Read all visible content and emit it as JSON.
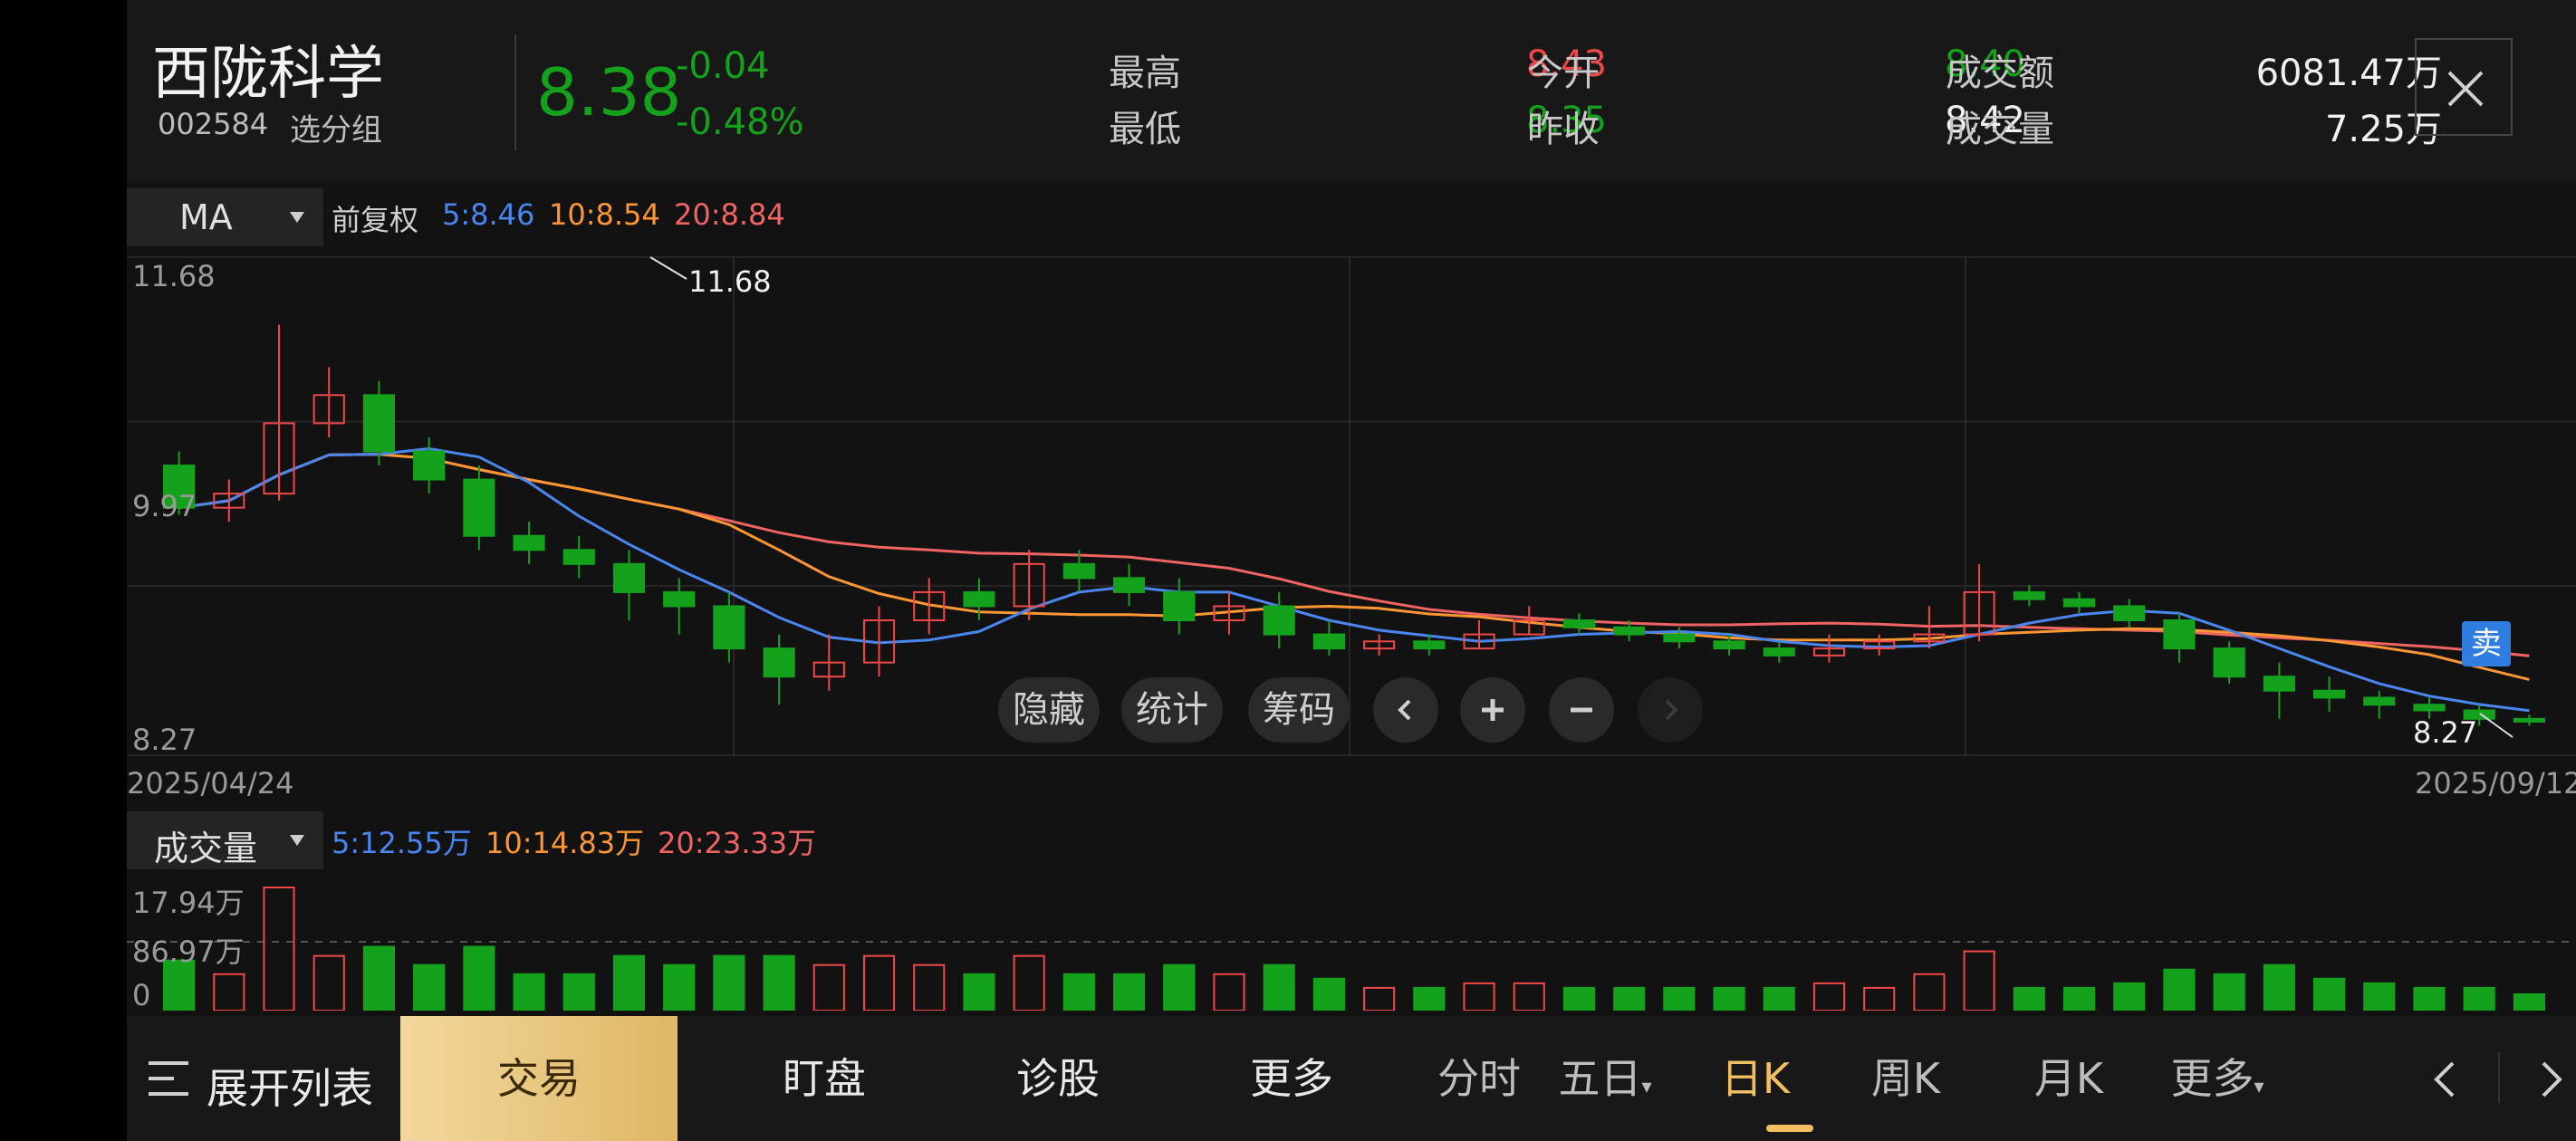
{
  "stock": {
    "name": "西陇科学",
    "code": "002584",
    "group_label": "选分组",
    "price": "8.38",
    "change": "-0.04",
    "change_pct": "-0.48%"
  },
  "stats": {
    "high_label": "最高",
    "high": "8.43",
    "low_label": "最低",
    "low": "8.35",
    "open_label": "今开",
    "open": "8.40",
    "prev_close_label": "昨收",
    "prev_close": "8.42",
    "amount_label": "成交额",
    "amount": "6081.47万",
    "volume_label": "成交量",
    "volume": "7.25万"
  },
  "price_chart": {
    "indicator": "MA",
    "adjust_label": "前复权",
    "ma5": "5:8.46",
    "ma10": "10:8.54",
    "ma20": "20:8.84",
    "y_top": "11.68",
    "y_mid": "9.97",
    "y_bottom": "8.27",
    "max_marker": "11.68",
    "min_marker": "8.27",
    "start_date": "2025/04/24",
    "end_date": "2025/09/12",
    "sell_badge": "卖"
  },
  "controls": {
    "hide": "隐藏",
    "stats": "统计",
    "chips": "筹码"
  },
  "volume_chart": {
    "indicator": "成交量",
    "ma5": "5:12.55万",
    "ma10": "10:14.83万",
    "ma20": "20:23.33万",
    "y_top": "17.94万",
    "y_mid": "86.97万",
    "y_zero": "0"
  },
  "bottom_bar": {
    "expand_list": "展开列表",
    "trade": "交易",
    "watch": "盯盘",
    "diagnose": "诊股",
    "more": "更多",
    "tabs": [
      "分时",
      "五日",
      "日K",
      "周K",
      "月K",
      "更多"
    ],
    "active_tab": "日K"
  },
  "colors": {
    "up": "#f04848",
    "down": "#14a21c",
    "ma5": "#4a86f0",
    "ma10": "#ff9633",
    "ma20": "#f06464",
    "active_tab": "#f2c060"
  },
  "icons": [
    "close-icon",
    "dropdown-arrow-icon",
    "chevron-left-icon",
    "plus-icon",
    "minus-icon",
    "chevron-right-icon",
    "list-icon"
  ],
  "chart_data": {
    "type": "candlestick",
    "x_range": [
      "2025/04/24",
      "2025/09/12"
    ],
    "y_range": [
      8.27,
      11.68
    ],
    "y_ticks": [
      "11.68",
      "9.97",
      "8.27"
    ],
    "candles": [
      [
        10.2,
        9.9,
        10.3,
        9.85
      ],
      [
        9.9,
        10.0,
        10.1,
        9.8
      ],
      [
        10.0,
        10.5,
        11.2,
        9.95
      ],
      [
        10.5,
        10.7,
        10.9,
        10.4
      ],
      [
        10.7,
        10.3,
        10.8,
        10.2
      ],
      [
        10.3,
        10.1,
        10.4,
        10.0
      ],
      [
        10.1,
        9.7,
        10.2,
        9.6
      ],
      [
        9.7,
        9.6,
        9.8,
        9.5
      ],
      [
        9.6,
        9.5,
        9.7,
        9.4
      ],
      [
        9.5,
        9.3,
        9.6,
        9.1
      ],
      [
        9.3,
        9.2,
        9.4,
        9.0
      ],
      [
        9.2,
        8.9,
        9.3,
        8.8
      ],
      [
        8.9,
        8.7,
        9.0,
        8.5
      ],
      [
        8.7,
        8.8,
        9.0,
        8.6
      ],
      [
        8.8,
        9.1,
        9.2,
        8.7
      ],
      [
        9.1,
        9.3,
        9.4,
        9.0
      ],
      [
        9.3,
        9.2,
        9.4,
        9.1
      ],
      [
        9.2,
        9.5,
        9.6,
        9.1
      ],
      [
        9.5,
        9.4,
        9.6,
        9.3
      ],
      [
        9.4,
        9.3,
        9.5,
        9.2
      ],
      [
        9.3,
        9.1,
        9.4,
        9.0
      ],
      [
        9.1,
        9.2,
        9.3,
        9.0
      ],
      [
        9.2,
        9.0,
        9.3,
        8.9
      ],
      [
        9.0,
        8.9,
        9.1,
        8.85
      ],
      [
        8.9,
        8.95,
        9.0,
        8.85
      ],
      [
        8.95,
        8.9,
        9.0,
        8.85
      ],
      [
        8.9,
        9.0,
        9.1,
        8.9
      ],
      [
        9.0,
        9.1,
        9.2,
        9.0
      ],
      [
        9.1,
        9.05,
        9.15,
        9.0
      ],
      [
        9.05,
        9.0,
        9.1,
        8.95
      ],
      [
        9.0,
        8.95,
        9.05,
        8.9
      ],
      [
        8.95,
        8.9,
        9.0,
        8.85
      ],
      [
        8.9,
        8.85,
        8.95,
        8.8
      ],
      [
        8.85,
        8.9,
        9.0,
        8.8
      ],
      [
        8.9,
        8.95,
        9.0,
        8.85
      ],
      [
        8.95,
        9.0,
        9.2,
        8.9
      ],
      [
        9.0,
        9.3,
        9.5,
        8.95
      ],
      [
        9.3,
        9.25,
        9.35,
        9.2
      ],
      [
        9.25,
        9.2,
        9.3,
        9.15
      ],
      [
        9.2,
        9.1,
        9.25,
        9.05
      ],
      [
        9.1,
        8.9,
        9.15,
        8.8
      ],
      [
        8.9,
        8.7,
        8.95,
        8.65
      ],
      [
        8.7,
        8.6,
        8.8,
        8.4
      ],
      [
        8.6,
        8.55,
        8.7,
        8.45
      ],
      [
        8.55,
        8.5,
        8.6,
        8.4
      ],
      [
        8.5,
        8.46,
        8.55,
        8.4
      ],
      [
        8.46,
        8.4,
        8.5,
        8.35
      ],
      [
        8.4,
        8.38,
        8.43,
        8.35
      ]
    ],
    "ma5": 8.46,
    "ma10": 8.54,
    "ma20": 8.84,
    "max_marker": 11.68,
    "min_marker": 8.27
  }
}
